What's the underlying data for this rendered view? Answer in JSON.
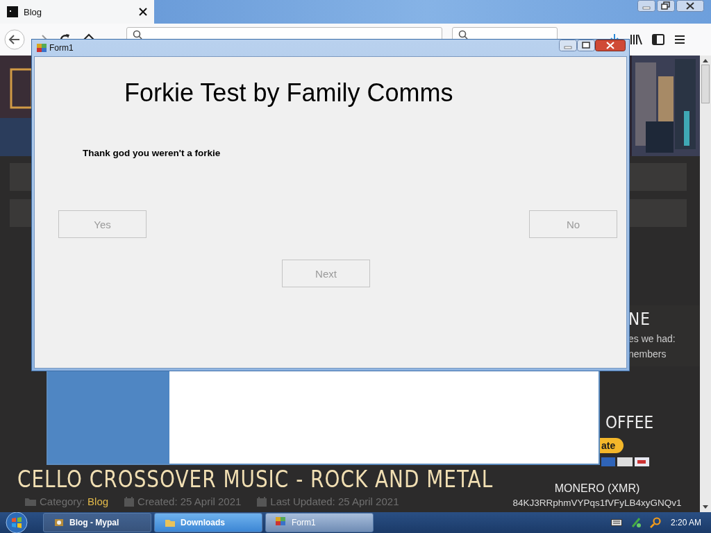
{
  "browser": {
    "tabs": [
      {
        "title": "Blog",
        "selected": true
      }
    ]
  },
  "page": {
    "sidebar": {
      "heading_1": "NE",
      "lines": [
        "es we had:",
        "nembers"
      ],
      "heading_2": "OFFEE",
      "donate_button": "ate",
      "monero_title": "MONERO (XMR)",
      "monero_address": "84KJ3RRphmVYPqs1fVFyLB4xyGNQv1"
    },
    "article": {
      "title": "CELLO CROSSOVER MUSIC - ROCK AND METAL",
      "meta": [
        {
          "kind": "category",
          "label": "Category:",
          "value": "Blog"
        },
        {
          "kind": "created",
          "label": "Created: 25 April 2021"
        },
        {
          "kind": "updated",
          "label": "Last Updated: 25 April 2021"
        }
      ]
    }
  },
  "dialog": {
    "title": "Form1",
    "heading": "Forkie Test by Family Comms",
    "message": "Thank god you weren't a forkie",
    "buttons": [
      {
        "kind": "yes",
        "label": "Yes",
        "disabled": true
      },
      {
        "kind": "no",
        "label": "No",
        "disabled": true
      },
      {
        "kind": "next",
        "label": "Next",
        "disabled": true
      }
    ]
  },
  "taskbar": {
    "tasks": [
      {
        "label": "Blog - Mypal",
        "selected": false,
        "hovered": false
      },
      {
        "label": "Downloads",
        "selected": false,
        "hovered": true
      },
      {
        "label": "Form1",
        "selected": true,
        "hovered": false
      }
    ],
    "clock": "2:20 AM"
  }
}
